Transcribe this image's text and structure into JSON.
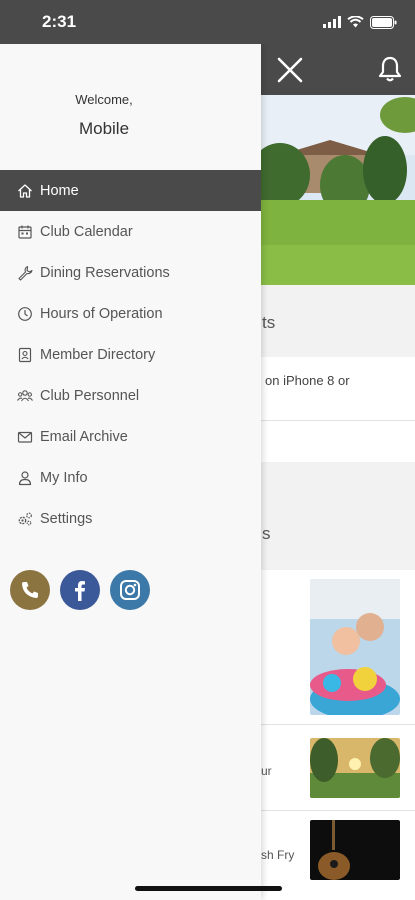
{
  "status_bar": {
    "time": "2:31"
  },
  "drawer": {
    "welcome_line": "Welcome,",
    "user_name": "Mobile",
    "menu_items": [
      {
        "label": "Home",
        "icon": "home-icon"
      },
      {
        "label": "Club Calendar",
        "icon": "calendar-icon"
      },
      {
        "label": "Dining Reservations",
        "icon": "wrench-icon"
      },
      {
        "label": "Hours of Operation",
        "icon": "clock-icon"
      },
      {
        "label": "Member Directory",
        "icon": "contact-card-icon"
      },
      {
        "label": "Club Personnel",
        "icon": "people-icon"
      },
      {
        "label": "Email Archive",
        "icon": "envelope-icon"
      },
      {
        "label": "My Info",
        "icon": "person-icon"
      },
      {
        "label": "Settings",
        "icon": "gears-icon"
      }
    ],
    "socials": [
      {
        "name": "phone",
        "icon": "phone-icon",
        "color": "#8b7440"
      },
      {
        "name": "facebook",
        "icon": "facebook-icon",
        "color": "#3b5998"
      },
      {
        "name": "instagram",
        "icon": "instagram-icon",
        "color": "#3d79a8"
      }
    ]
  },
  "background": {
    "section1_label_fragment": "ts",
    "note_fragment": "on iPhone 8 or",
    "section2_label_fragment": "s",
    "rows": [
      {
        "text": ""
      },
      {
        "text": "ur"
      },
      {
        "text": "sh Fry"
      }
    ]
  },
  "colors": {
    "bar": "#4a4a4a",
    "accent_gold": "#8b7440"
  }
}
